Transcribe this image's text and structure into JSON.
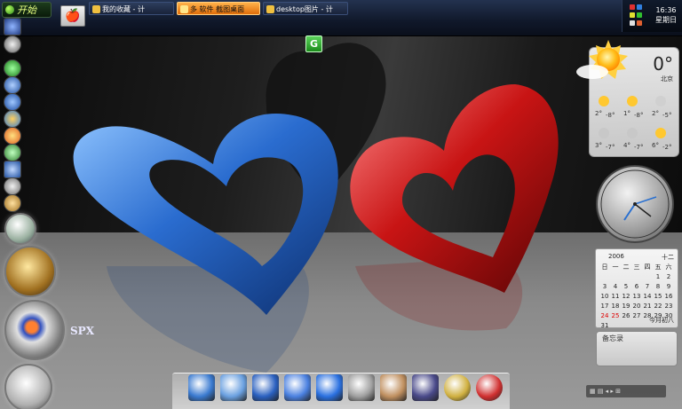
{
  "taskbar": {
    "start_label": "开始",
    "tasks": [
      {
        "label": "我的收藏 - 计"
      },
      {
        "label": "多 软件 截图桌面"
      },
      {
        "label": "desktop图片 - 计"
      }
    ],
    "clock_lines": [
      "16:36",
      "星期日"
    ]
  },
  "left_dock": {
    "spx_label": "SPX"
  },
  "weather": {
    "temp": "0°",
    "city": "北京",
    "forecast": [
      {
        "temp": "2°",
        "low": "-8°"
      },
      {
        "temp": "1°",
        "low": "-8°"
      },
      {
        "temp": "2°",
        "low": "-5°"
      },
      {
        "temp": "3°",
        "low": "-7°"
      },
      {
        "temp": "4°",
        "low": "-7°"
      },
      {
        "temp": "6°",
        "low": "-2°"
      }
    ]
  },
  "calendar": {
    "year": "2006",
    "month": "十二",
    "weekdays": [
      "日",
      "一",
      "二",
      "三",
      "四",
      "五",
      "六"
    ],
    "days": [
      "",
      "",
      "",
      "",
      "",
      "1",
      "2",
      "3",
      "4",
      "5",
      "6",
      "7",
      "8",
      "9",
      "10",
      "11",
      "12",
      "13",
      "14",
      "15",
      "16",
      "17",
      "18",
      "19",
      "20",
      "21",
      "22",
      "23",
      "24",
      "25",
      "26",
      "27",
      "28",
      "29",
      "30",
      "31"
    ],
    "today_label": "今月初八"
  },
  "notes": {
    "title": "备忘录"
  },
  "colors": {
    "taskbar": "#10182a",
    "active_task": "#e06d0a",
    "heart_blue": "#2a6ccf",
    "heart_red": "#c81414"
  },
  "icons": {
    "dock": [
      "monitor-icon",
      "documents-icon",
      "internet-explorer-icon",
      "network-icon",
      "settings-gear-icon",
      "recycle-bin-icon",
      "box-icon",
      "hat-icon",
      "lock-icon",
      "apple-icon"
    ]
  }
}
